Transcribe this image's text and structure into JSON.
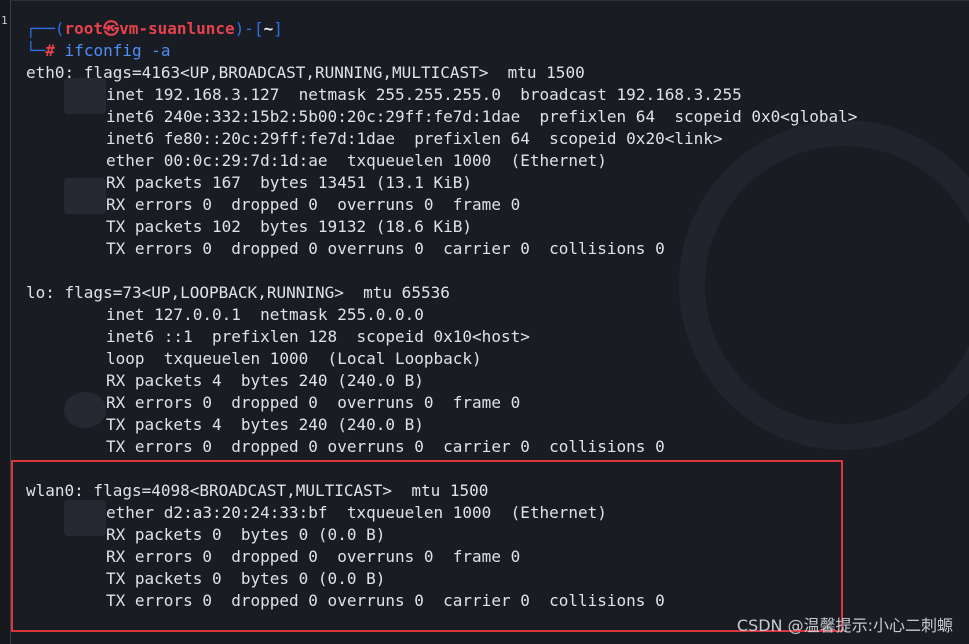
{
  "prompt": {
    "open": "┌──(",
    "user": "root㉿vm-suanlunce",
    "close": ")-[",
    "dir": "~",
    "end": "]",
    "corner": "└─",
    "hash": "#",
    "command": "ifconfig -a"
  },
  "blocks": [
    {
      "header": "eth0: flags=4163<UP,BROADCAST,RUNNING,MULTICAST>  mtu 1500",
      "lines": [
        "inet 192.168.3.127  netmask 255.255.255.0  broadcast 192.168.3.255",
        "inet6 240e:332:15b2:5b00:20c:29ff:fe7d:1dae  prefixlen 64  scopeid 0x0<global>",
        "inet6 fe80::20c:29ff:fe7d:1dae  prefixlen 64  scopeid 0x20<link>",
        "ether 00:0c:29:7d:1d:ae  txqueuelen 1000  (Ethernet)",
        "RX packets 167  bytes 13451 (13.1 KiB)",
        "RX errors 0  dropped 0  overruns 0  frame 0",
        "TX packets 102  bytes 19132 (18.6 KiB)",
        "TX errors 0  dropped 0 overruns 0  carrier 0  collisions 0"
      ]
    },
    {
      "header": "lo: flags=73<UP,LOOPBACK,RUNNING>  mtu 65536",
      "lines": [
        "inet 127.0.0.1  netmask 255.0.0.0",
        "inet6 ::1  prefixlen 128  scopeid 0x10<host>",
        "loop  txqueuelen 1000  (Local Loopback)",
        "RX packets 4  bytes 240 (240.0 B)",
        "RX errors 0  dropped 0  overruns 0  frame 0",
        "TX packets 4  bytes 240 (240.0 B)",
        "TX errors 0  dropped 0 overruns 0  carrier 0  collisions 0"
      ]
    },
    {
      "header": "wlan0: flags=4098<BROADCAST,MULTICAST>  mtu 1500",
      "lines": [
        "ether d2:a3:20:24:33:bf  txqueuelen 1000  (Ethernet)",
        "RX packets 0  bytes 0 (0.0 B)",
        "RX errors 0  dropped 0  overruns 0  frame 0",
        "TX packets 0  bytes 0 (0.0 B)",
        "TX errors 0  dropped 0 overruns 0  carrier 0  collisions 0"
      ]
    }
  ],
  "gutter_number": "1",
  "watermark": "CSDN @温馨提示:小心二刺螈",
  "colors": {
    "background": "#1a1c23",
    "prompt_frame": "#2f6fe6",
    "prompt_user": "#e5424d",
    "command": "#4f8df5",
    "highlight_box": "#d9363e"
  }
}
